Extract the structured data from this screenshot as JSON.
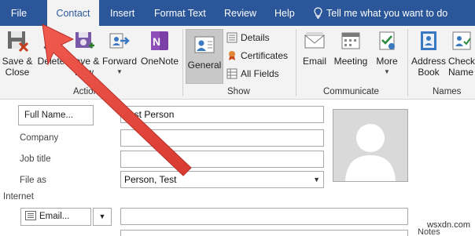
{
  "tabs": {
    "file": "File",
    "contact": "Contact",
    "insert": "Insert",
    "format_text": "Format Text",
    "review": "Review",
    "help": "Help",
    "tell_me": "Tell me what you want to do"
  },
  "ribbon": {
    "actions": {
      "save_close_line1": "Save &",
      "save_close_line2": "Close",
      "delete": "Delete",
      "save_new_line1": "Save &",
      "save_new_line2": "New",
      "forward": "Forward",
      "onenote": "OneNote",
      "group_label": "Actions"
    },
    "show": {
      "general": "General",
      "details": "Details",
      "certificates": "Certificates",
      "all_fields": "All Fields",
      "group_label": "Show"
    },
    "communicate": {
      "email": "Email",
      "meeting": "Meeting",
      "more": "More",
      "group_label": "Communicate"
    },
    "names": {
      "address_book_line1": "Address",
      "address_book_line2": "Book",
      "check_names_line1": "Check",
      "check_names_line2": "Name",
      "group_label": "Names"
    }
  },
  "form": {
    "full_name_button": "Full Name...",
    "full_name_value": "Test Person",
    "company_label": "Company",
    "company_value": "",
    "job_title_label": "Job title",
    "job_title_value": "",
    "file_as_label": "File as",
    "file_as_value": "Person, Test",
    "internet_label": "Internet",
    "email_button": "Email...",
    "email_value": "",
    "notes_label": "Notes"
  },
  "watermark": "wsxdn.com",
  "colors": {
    "tab_bar": "#2b579a",
    "ribbon_bg": "#f3f3f3",
    "annotation_arrow": "#e8463f"
  }
}
